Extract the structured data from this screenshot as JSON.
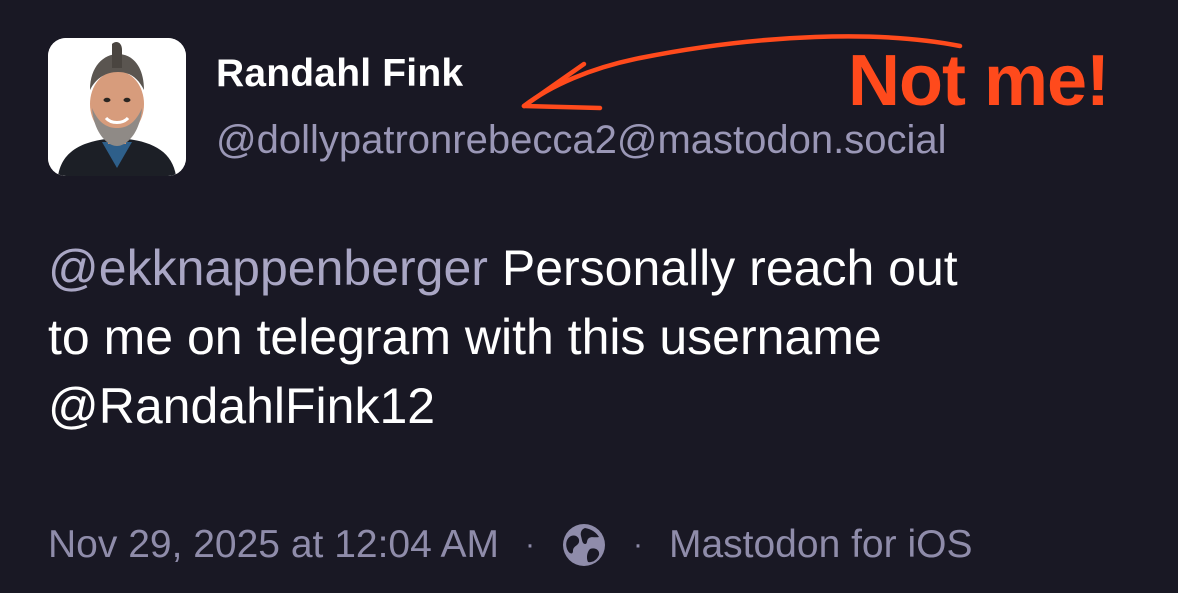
{
  "post": {
    "author": {
      "display_name": "Randahl Fink",
      "handle": "@dollypatronrebecca2@mastodon.social",
      "avatar_icon": "person-avatar"
    },
    "annotation": {
      "text": "Not me!",
      "color": "#ff4a1c"
    },
    "body": {
      "mention": "@ekknappenberger",
      "line1_text": " Personally reach out",
      "line2_text": "to me on telegram with this username",
      "line3_text": "@RandahlFink12"
    },
    "meta": {
      "timestamp": "Nov 29, 2025 at 12:04 AM",
      "separator": "·",
      "visibility_icon": "globe-icon",
      "client": "Mastodon for iOS"
    }
  },
  "colors": {
    "background": "#191824",
    "text_primary": "#ffffff",
    "text_secondary": "#9a97b6",
    "accent_annotation": "#ff4a1c"
  }
}
